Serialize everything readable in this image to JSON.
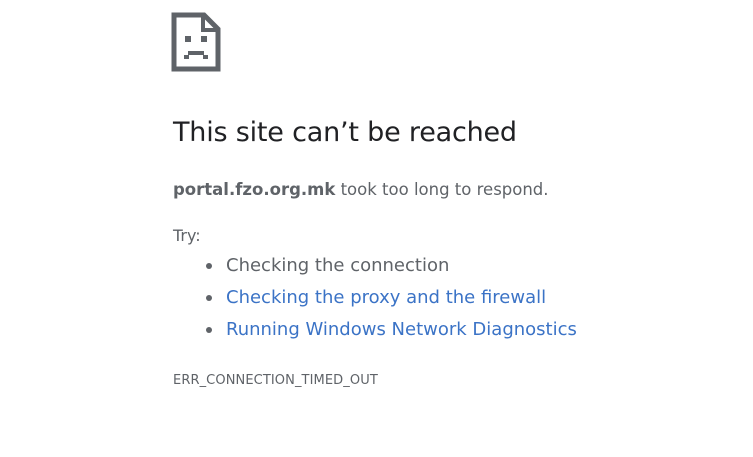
{
  "error": {
    "icon": "sad-page-icon",
    "title": "This site can’t be reached",
    "host": "portal.fzo.org.mk",
    "summary_suffix": " took too long to respond.",
    "try_label": "Try:",
    "suggestions": [
      {
        "text": "Checking the connection",
        "is_link": false
      },
      {
        "text": "Checking the proxy and the firewall",
        "is_link": true
      },
      {
        "text": "Running Windows Network Diagnostics",
        "is_link": true
      }
    ],
    "code": "ERR_CONNECTION_TIMED_OUT"
  },
  "colors": {
    "link": "#3b73c6",
    "text": "#5f6368",
    "title": "#202124",
    "icon": "#5f6368"
  }
}
